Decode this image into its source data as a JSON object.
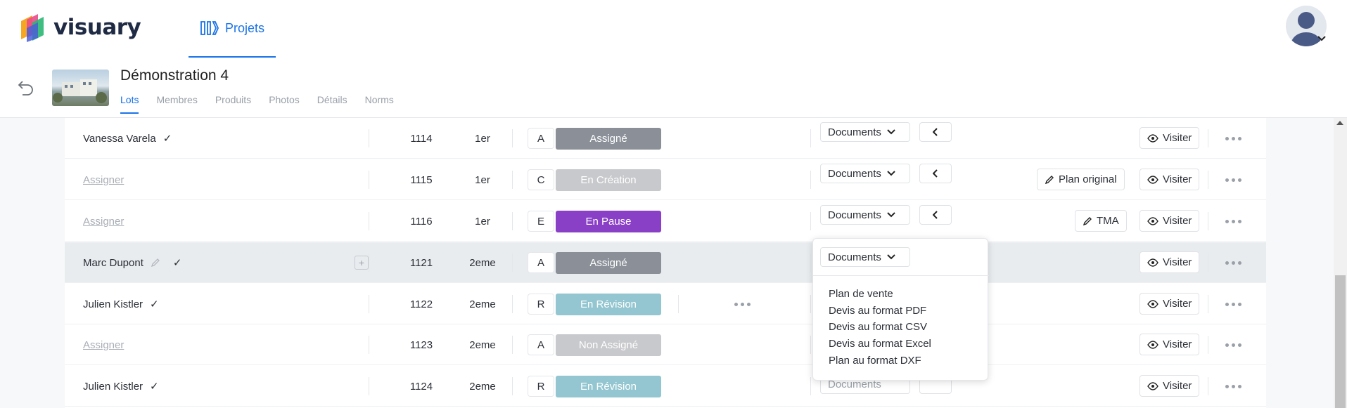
{
  "app": {
    "logo_text": "visuary",
    "nav_projets": "Projets"
  },
  "project": {
    "title": "Démonstration 4",
    "tabs": [
      "Lots",
      "Membres",
      "Produits",
      "Photos",
      "Détails",
      "Norms"
    ],
    "active_tab": "Lots"
  },
  "rows": [
    {
      "name": "Vanessa Varela",
      "check": "✓",
      "num": "1114",
      "floor": "1er",
      "letter": "A",
      "status": "Assigné",
      "status_color": "#8a8f98",
      "docs": "Documents",
      "extra": "",
      "visit": "Visiter"
    },
    {
      "name": "Assigner",
      "check": "",
      "num": "1115",
      "floor": "1er",
      "letter": "C",
      "status": "En Création",
      "status_color": "#c8c9cc",
      "docs": "Documents",
      "extra": "Plan original",
      "visit": "Visiter"
    },
    {
      "name": "Assigner",
      "check": "",
      "num": "1116",
      "floor": "1er",
      "letter": "E",
      "status": "En Pause",
      "status_color": "#8a3fc7",
      "docs": "Documents",
      "extra": "TMA",
      "visit": "Visiter"
    },
    {
      "name": "Marc Dupont",
      "check": "✓",
      "num": "1121",
      "floor": "2eme",
      "letter": "A",
      "status": "Assigné",
      "status_color": "#8a8f98",
      "docs": "",
      "extra": "",
      "visit": "Visiter"
    },
    {
      "name": "Julien Kistler",
      "check": "✓",
      "num": "1122",
      "floor": "2eme",
      "letter": "R",
      "status": "En Révision",
      "status_color": "#93c6d0",
      "docs": "",
      "extra": "",
      "visit": "Visiter"
    },
    {
      "name": "Assigner",
      "check": "",
      "num": "1123",
      "floor": "2eme",
      "letter": "A",
      "status": "Non Assigné",
      "status_color": "#c8c9cc",
      "docs": "",
      "extra": "",
      "visit": "Visiter"
    },
    {
      "name": "Julien Kistler",
      "check": "✓",
      "num": "1124",
      "floor": "2eme",
      "letter": "R",
      "status": "En Révision",
      "status_color": "#93c6d0",
      "docs": "Documents",
      "extra": "",
      "visit": "Visiter"
    }
  ],
  "dropdown": {
    "button": "Documents",
    "items": [
      "Plan de vente",
      "Devis au format PDF",
      "Devis au format CSV",
      "Devis au format Excel",
      "Plan au format DXF"
    ]
  },
  "icons": {
    "check": "check-icon",
    "pencil": "pencil-icon",
    "eye": "eye-icon",
    "chevron": "chevron-down-icon",
    "chevron_left": "chevron-left-icon",
    "more": "more-dots-icon",
    "plus": "plus-icon",
    "back": "undo-icon"
  },
  "colors": {
    "accent": "#1a73e8"
  }
}
